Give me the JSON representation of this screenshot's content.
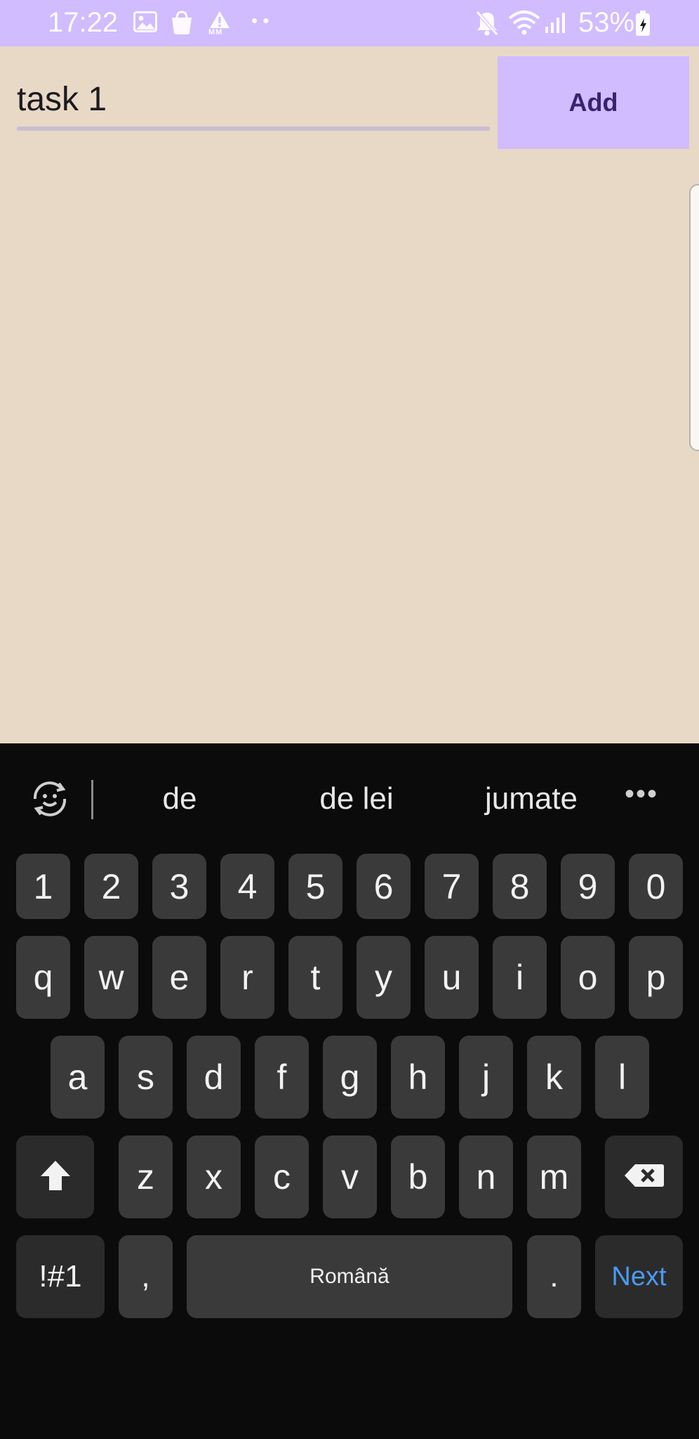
{
  "status_bar": {
    "time": "17:22",
    "battery_percent": "53%",
    "icons": [
      "gallery-icon",
      "shopping-bag-icon",
      "alert-icon",
      "more-notifications-icon",
      "mute-icon",
      "wifi-icon",
      "signal-icon",
      "battery-icon"
    ],
    "alert_badge_text": "MM",
    "more_dots": "• •"
  },
  "form": {
    "task_value": "task 1",
    "add_label": "Add"
  },
  "colors": {
    "accent": "#d0bcff",
    "background": "#e8d9c7",
    "add_text": "#3a2270",
    "keyboard_bg": "#0b0b0b",
    "key_bg": "#3a3a3a",
    "next_text": "#4a9bf5"
  },
  "keyboard": {
    "suggestions": [
      "de",
      "de lei",
      "jumate"
    ],
    "more": "•••",
    "row_numbers": [
      "1",
      "2",
      "3",
      "4",
      "5",
      "6",
      "7",
      "8",
      "9",
      "0"
    ],
    "row1": [
      "q",
      "w",
      "e",
      "r",
      "t",
      "y",
      "u",
      "i",
      "o",
      "p"
    ],
    "row2": [
      "a",
      "s",
      "d",
      "f",
      "g",
      "h",
      "j",
      "k",
      "l"
    ],
    "row3": [
      "z",
      "x",
      "c",
      "v",
      "b",
      "n",
      "m"
    ],
    "symbols_label": "!#1",
    "comma_label": ",",
    "space_label": "Română",
    "period_label": ".",
    "next_label": "Next"
  }
}
